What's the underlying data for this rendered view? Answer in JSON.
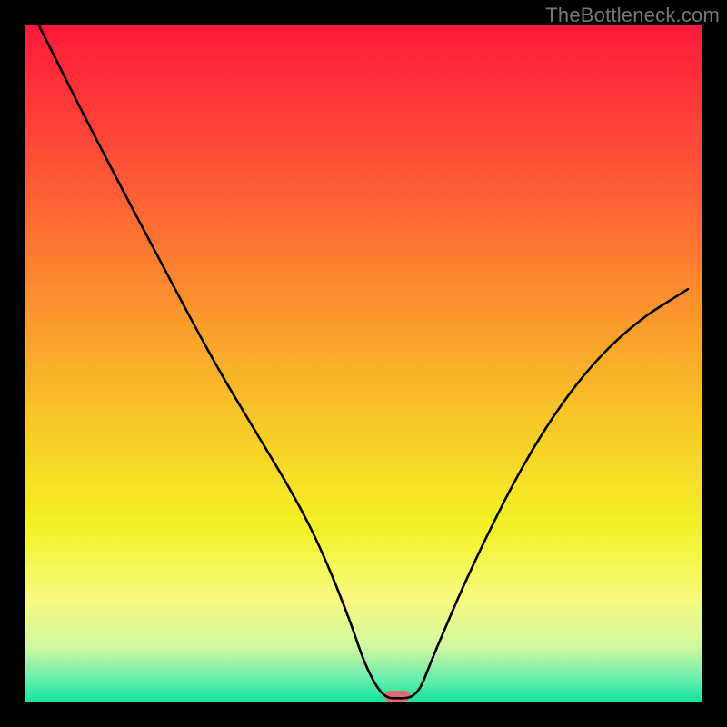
{
  "watermark": "TheBottleneck.com",
  "chart_data": {
    "type": "line",
    "title": "",
    "xlabel": "",
    "ylabel": "",
    "xlim": [
      0,
      100
    ],
    "ylim": [
      0,
      100
    ],
    "series": [
      {
        "name": "bottleneck-curve",
        "x": [
          2,
          10,
          20,
          28,
          34,
          40,
          44,
          48,
          50,
          52,
          53.5,
          55,
          57,
          58.5,
          60,
          66,
          74,
          82,
          90,
          98
        ],
        "values": [
          100,
          84,
          65,
          50,
          40,
          30,
          22,
          12,
          6,
          2,
          0.5,
          0.5,
          0.5,
          2,
          6,
          20,
          36,
          48,
          56,
          61
        ]
      }
    ],
    "optimal_marker": {
      "x_center": 55,
      "width": 3.8,
      "color": "#e46a74"
    },
    "gradient_stops": [
      {
        "pos": 0.0,
        "color": "#fe1a3a"
      },
      {
        "pos": 0.2,
        "color": "#fd5037"
      },
      {
        "pos": 0.4,
        "color": "#fb8f2f"
      },
      {
        "pos": 0.58,
        "color": "#f8c628"
      },
      {
        "pos": 0.74,
        "color": "#f4f226"
      },
      {
        "pos": 0.85,
        "color": "#f8fb82"
      },
      {
        "pos": 0.92,
        "color": "#d0f8a0"
      },
      {
        "pos": 0.965,
        "color": "#6bedae"
      },
      {
        "pos": 1.0,
        "color": "#15e59e"
      }
    ]
  }
}
